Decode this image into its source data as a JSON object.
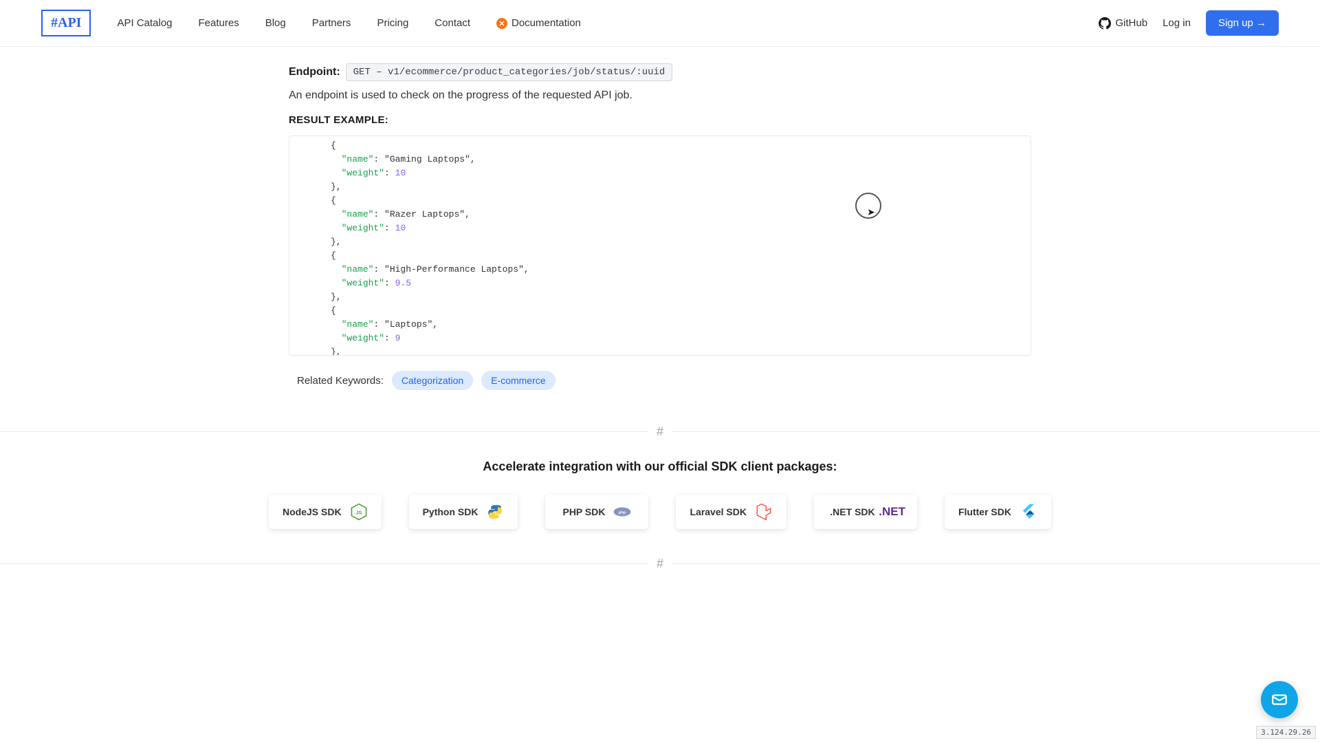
{
  "header": {
    "logo": "#API",
    "nav": {
      "catalog": "API Catalog",
      "features": "Features",
      "blog": "Blog",
      "partners": "Partners",
      "pricing": "Pricing",
      "contact": "Contact",
      "documentation": "Documentation",
      "github": "GitHub",
      "login": "Log in",
      "signup": "Sign up →"
    }
  },
  "content": {
    "endpoint_label": "Endpoint:",
    "endpoint_code": "GET – v1/ecommerce/product_categories/job/status/:uuid",
    "description": "An endpoint is used to check on the progress of the requested API job.",
    "result_label": "RESULT EXAMPLE:",
    "code_items": [
      {
        "name": "Gaming Laptops",
        "weight": "10"
      },
      {
        "name": "Razer Laptops",
        "weight": "10"
      },
      {
        "name": "High-Performance Laptops",
        "weight": "9.5"
      },
      {
        "name": "Laptops",
        "weight": "9"
      }
    ],
    "related_label": "Related Keywords:",
    "tags": [
      "Categorization",
      "E-commerce"
    ]
  },
  "sdk": {
    "heading": "Accelerate integration with our official SDK client packages:",
    "items": [
      {
        "label": "NodeJS SDK",
        "icon": "nodejs"
      },
      {
        "label": "Python SDK",
        "icon": "python"
      },
      {
        "label": "PHP SDK",
        "icon": "php"
      },
      {
        "label": "Laravel SDK",
        "icon": "laravel"
      },
      {
        "label": ".NET SDK",
        "icon": "dotnet"
      },
      {
        "label": "Flutter SDK",
        "icon": "flutter"
      }
    ]
  },
  "divider_hash": "#",
  "ip": "3.124.29.26"
}
